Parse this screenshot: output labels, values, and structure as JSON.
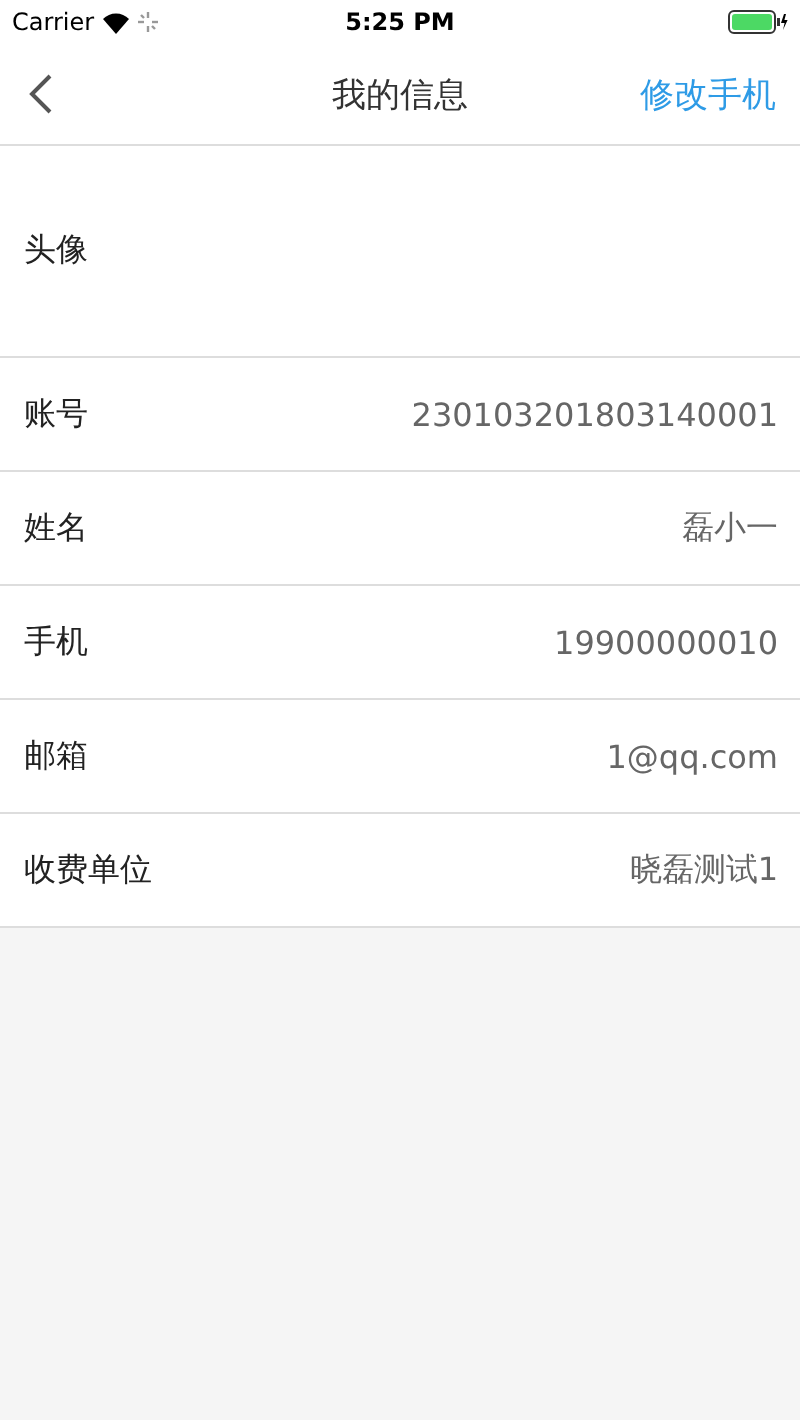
{
  "status_bar": {
    "carrier": "Carrier",
    "time": "5:25 PM"
  },
  "nav": {
    "title": "我的信息",
    "action": "修改手机"
  },
  "avatar_row": {
    "label": "头像"
  },
  "rows": [
    {
      "label": "账号",
      "value": "230103201803140001"
    },
    {
      "label": "姓名",
      "value": "磊小一"
    },
    {
      "label": "手机",
      "value": "19900000010"
    },
    {
      "label": "邮箱",
      "value": "1@qq.com"
    },
    {
      "label": "收费单位",
      "value": "晓磊测试1"
    }
  ]
}
